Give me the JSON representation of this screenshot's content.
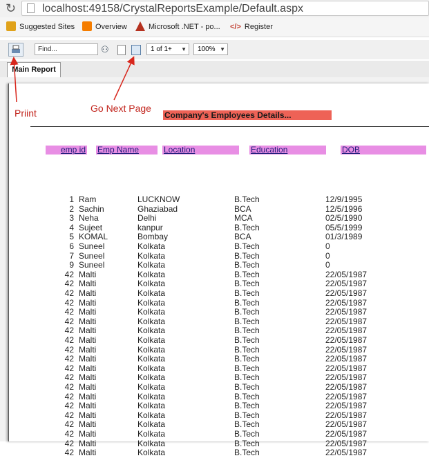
{
  "browser": {
    "url": "localhost:49158/CrystalReportsExample/Default.aspx",
    "bookmarks": [
      {
        "label": "Suggested Sites",
        "icon": "suggested-sites-icon",
        "color": "#e0a21a"
      },
      {
        "label": "Overview",
        "icon": "blogger-icon",
        "color": "#f57d00"
      },
      {
        "label": "Microsoft .NET - po...",
        "icon": "dotnet-icon",
        "color": "#b5311f"
      },
      {
        "label": "Register",
        "icon": "code-icon",
        "color": "#c0392b"
      }
    ]
  },
  "toolbar": {
    "find_placeholder": "Find...",
    "page_value": "1 of 1+",
    "zoom_value": "100%"
  },
  "tabs": {
    "main_report": "Main Report"
  },
  "annotations": {
    "print": "Priint",
    "next_page": "Go Next Page"
  },
  "report": {
    "title": "Company's Employees Details...",
    "headers": {
      "emp_id": "emp id",
      "emp_name": "Emp Name",
      "location": "Location",
      "education": "Education",
      "dob": "DOB"
    },
    "header_color": "#e88ee4",
    "title_color": "#ee6256",
    "rows": [
      [
        "1",
        "Ram",
        "LUCKNOW",
        "B.Tech",
        "12/9/1995"
      ],
      [
        "2",
        "Sachin",
        "Ghaziabad",
        "BCA",
        "12/5/1996"
      ],
      [
        "3",
        "Neha",
        "Delhi",
        "MCA",
        "02/5/1990"
      ],
      [
        "4",
        "Sujeet",
        "kanpur",
        "B.Tech",
        "05/5/1999"
      ],
      [
        "5",
        "KOMAL",
        "Bombay",
        "BCA",
        "01/3/1989"
      ],
      [
        "6",
        "Suneel",
        "Kolkata",
        "B.Tech",
        "0"
      ],
      [
        "7",
        "Suneel",
        "Kolkata",
        "B.Tech",
        "0"
      ],
      [
        "9",
        "Suneel",
        "Kolkata",
        "B.Tech",
        "0"
      ],
      [
        "42",
        "Malti",
        "Kolkata",
        "B.Tech",
        "22/05/1987"
      ],
      [
        "42",
        "Malti",
        "Kolkata",
        "B.Tech",
        "22/05/1987"
      ],
      [
        "42",
        "Malti",
        "Kolkata",
        "B.Tech",
        "22/05/1987"
      ],
      [
        "42",
        "Malti",
        "Kolkata",
        "B.Tech",
        "22/05/1987"
      ],
      [
        "42",
        "Malti",
        "Kolkata",
        "B.Tech",
        "22/05/1987"
      ],
      [
        "42",
        "Malti",
        "Kolkata",
        "B.Tech",
        "22/05/1987"
      ],
      [
        "42",
        "Malti",
        "Kolkata",
        "B.Tech",
        "22/05/1987"
      ],
      [
        "42",
        "Malti",
        "Kolkata",
        "B.Tech",
        "22/05/1987"
      ],
      [
        "42",
        "Malti",
        "Kolkata",
        "B.Tech",
        "22/05/1987"
      ],
      [
        "42",
        "Malti",
        "Kolkata",
        "B.Tech",
        "22/05/1987"
      ],
      [
        "42",
        "Malti",
        "Kolkata",
        "B.Tech",
        "22/05/1987"
      ],
      [
        "42",
        "Malti",
        "Kolkata",
        "B.Tech",
        "22/05/1987"
      ],
      [
        "42",
        "Malti",
        "Kolkata",
        "B.Tech",
        "22/05/1987"
      ],
      [
        "42",
        "Malti",
        "Kolkata",
        "B.Tech",
        "22/05/1987"
      ],
      [
        "42",
        "Malti",
        "Kolkata",
        "B.Tech",
        "22/05/1987"
      ],
      [
        "42",
        "Malti",
        "Kolkata",
        "B.Tech",
        "22/05/1987"
      ],
      [
        "42",
        "Malti",
        "Kolkata",
        "B.Tech",
        "22/05/1987"
      ],
      [
        "42",
        "Malti",
        "Kolkata",
        "B.Tech",
        "22/05/1987"
      ],
      [
        "42",
        "Malti",
        "Kolkata",
        "B.Tech",
        "22/05/1987"
      ],
      [
        "42",
        "Malti",
        "Kolkata",
        "B.Tech",
        "22/05/1987"
      ]
    ]
  }
}
